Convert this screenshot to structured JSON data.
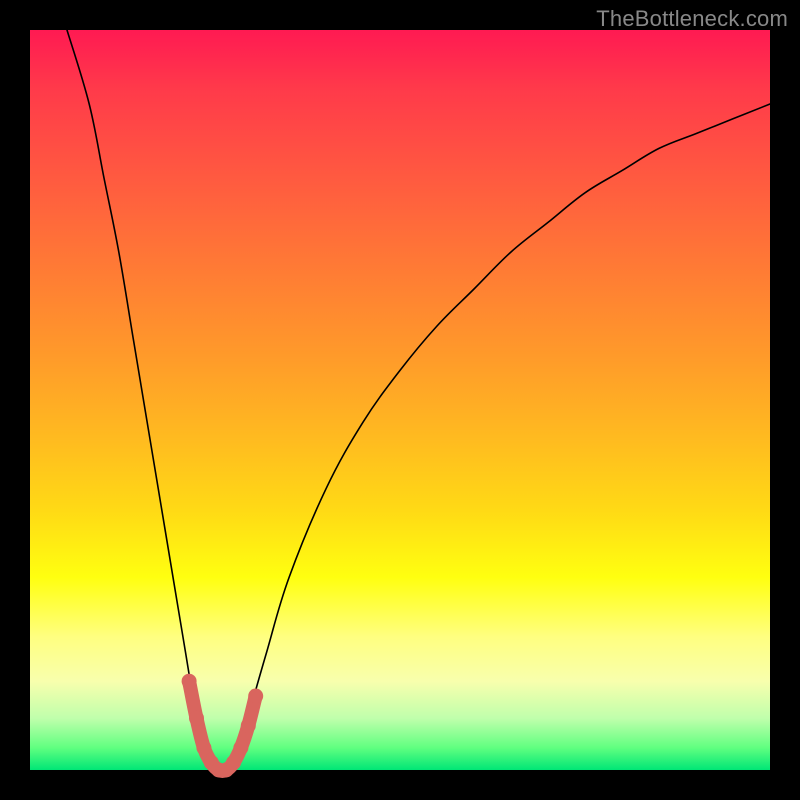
{
  "watermark": "TheBottleneck.com",
  "chart_data": {
    "type": "line",
    "title": "",
    "xlabel": "",
    "ylabel": "",
    "xlim": [
      0,
      100
    ],
    "ylim": [
      0,
      100
    ],
    "background_gradient": {
      "direction": "top-to-bottom",
      "stops": [
        {
          "pos": 0,
          "color": "#ff1a52"
        },
        {
          "pos": 74,
          "color": "#ffff10"
        },
        {
          "pos": 100,
          "color": "#00e676"
        }
      ],
      "meaning": "red = high bottleneck, green = no bottleneck"
    },
    "series": [
      {
        "name": "bottleneck-curve",
        "x": [
          5,
          8,
          10,
          12,
          14,
          16,
          18,
          20,
          21,
          22,
          23,
          24,
          25,
          26,
          27,
          28,
          29,
          30,
          32,
          35,
          40,
          45,
          50,
          55,
          60,
          65,
          70,
          75,
          80,
          85,
          90,
          95,
          100
        ],
        "values": [
          100,
          90,
          80,
          70,
          58,
          46,
          34,
          22,
          16,
          10,
          5,
          2,
          0,
          0,
          0,
          2,
          5,
          9,
          16,
          26,
          38,
          47,
          54,
          60,
          65,
          70,
          74,
          78,
          81,
          84,
          86,
          88,
          90
        ]
      }
    ],
    "highlight_band": {
      "name": "near-zero-bottleneck-region",
      "x": [
        21.5,
        22.5,
        23.5,
        24.5,
        25.5,
        26.5,
        27.5,
        28.5,
        29.5,
        30.5
      ],
      "values": [
        12,
        7,
        3,
        1,
        0,
        0,
        1,
        3,
        6,
        10
      ],
      "color": "#d9655e"
    },
    "notes": "No axes, labels, legend, or numeric ticks are visible; numeric values are estimates based on curve geometry relative to the plot frame."
  }
}
